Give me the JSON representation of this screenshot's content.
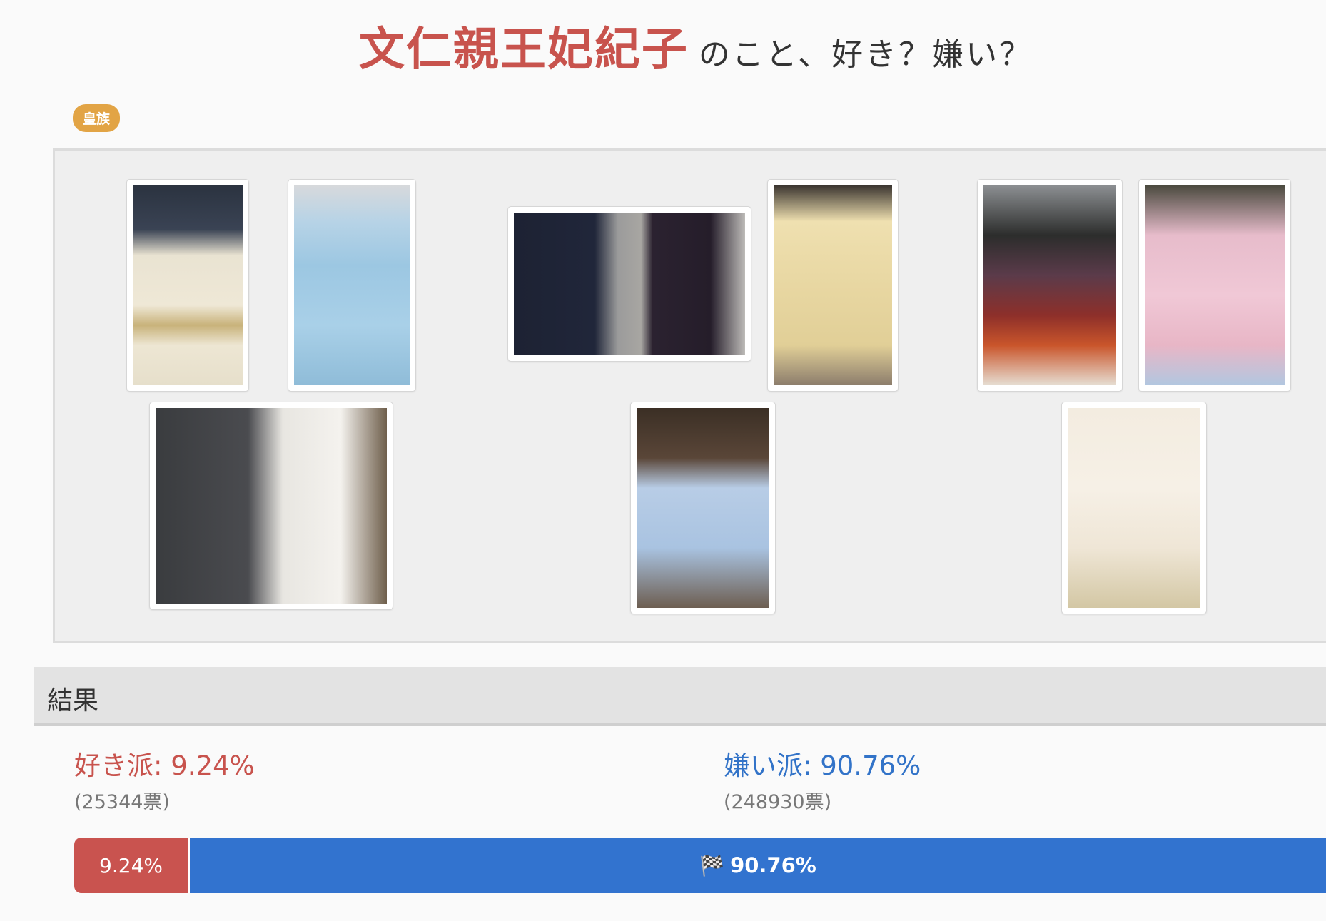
{
  "title": {
    "name": "文仁親王妃紀子",
    "question": "のこと、好き？嫌い？"
  },
  "tag": "皇族",
  "gallery": {
    "photos": [
      {
        "id": "photo-1",
        "subject": "kimono portrait"
      },
      {
        "id": "photo-2",
        "subject": "light blue outfit with hat"
      },
      {
        "id": "photo-3",
        "subject": "couple conversation"
      },
      {
        "id": "photo-4",
        "subject": "cream outfit with hat"
      },
      {
        "id": "photo-5",
        "subject": "traditional court dress"
      },
      {
        "id": "photo-6",
        "subject": "pink dress with bouquet"
      },
      {
        "id": "photo-7",
        "subject": "couple with baby"
      },
      {
        "id": "photo-8",
        "subject": "light blue suit"
      },
      {
        "id": "photo-9",
        "subject": "seated portrait"
      }
    ]
  },
  "results": {
    "heading": "結果",
    "like": {
      "label": "好き派: 9.24%",
      "votes": "(25344票)",
      "percent": 9.24,
      "bar_text": "9.24%",
      "color": "#c9534f"
    },
    "dislike": {
      "label": "嫌い派: 90.76%",
      "votes": "(248930票)",
      "percent": 90.76,
      "bar_text": "90.76%",
      "icon": "flag-icon",
      "color": "#3273cf"
    }
  }
}
